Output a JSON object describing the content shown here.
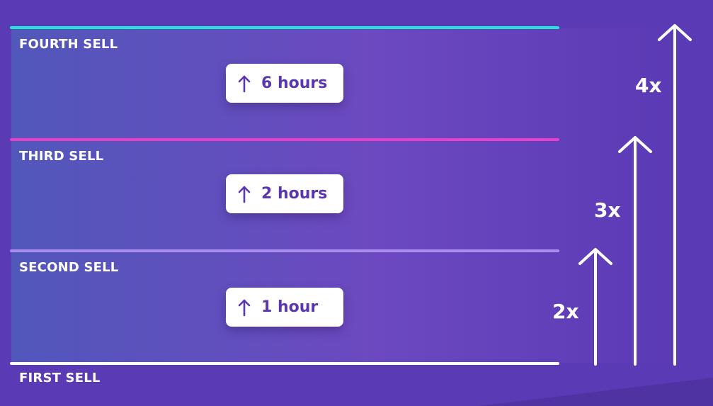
{
  "colors": {
    "background": "#5b3ab6",
    "fourth_line": "#1fe6d6",
    "third_line": "#e83fc9",
    "second_line": "#a98ef0",
    "first_line": "#ffffff",
    "pill_text": "#5a36b0"
  },
  "levels": [
    {
      "label": "FOURTH SELL",
      "color": "#1fe6d6"
    },
    {
      "label": "THIRD SELL",
      "color": "#e83fc9"
    },
    {
      "label": "SECOND SELL",
      "color": "#a98ef0"
    },
    {
      "label": "FIRST SELL",
      "color": "#ffffff"
    }
  ],
  "durations": [
    {
      "icon": "arrow-up-icon",
      "text": "6 hours"
    },
    {
      "icon": "arrow-up-icon",
      "text": "2 hours"
    },
    {
      "icon": "arrow-up-icon",
      "text": "1 hour"
    }
  ],
  "multipliers": [
    {
      "label": "2x",
      "icon": "arrow-up-icon"
    },
    {
      "label": "3x",
      "icon": "arrow-up-icon"
    },
    {
      "label": "4x",
      "icon": "arrow-up-icon"
    }
  ]
}
